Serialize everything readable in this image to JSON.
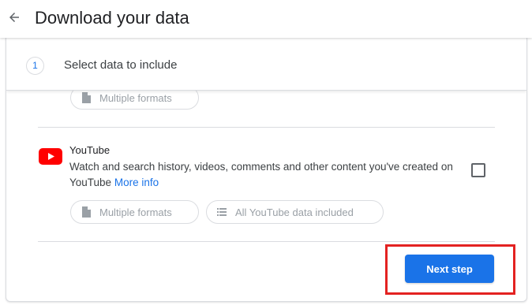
{
  "header": {
    "back_icon": "arrow-back-icon",
    "title": "Download your data"
  },
  "step": {
    "number": "1",
    "title": "Select data to include"
  },
  "previous_product": {
    "chips": [
      {
        "icon": "file-icon",
        "label": "Multiple formats"
      }
    ]
  },
  "product": {
    "name": "YouTube",
    "icon": "youtube-logo-icon",
    "description": "Watch and search history, videos, comments and other content you've created on YouTube",
    "more_info_label": "More info",
    "selected": false,
    "chips": [
      {
        "icon": "file-icon",
        "label": "Multiple formats"
      },
      {
        "icon": "list-icon",
        "label": "All YouTube data included"
      }
    ]
  },
  "actions": {
    "next_label": "Next step"
  },
  "colors": {
    "accent": "#1a73e8",
    "youtube_red": "#ff0000",
    "highlight": "#e32221",
    "divider": "#dadce0"
  }
}
